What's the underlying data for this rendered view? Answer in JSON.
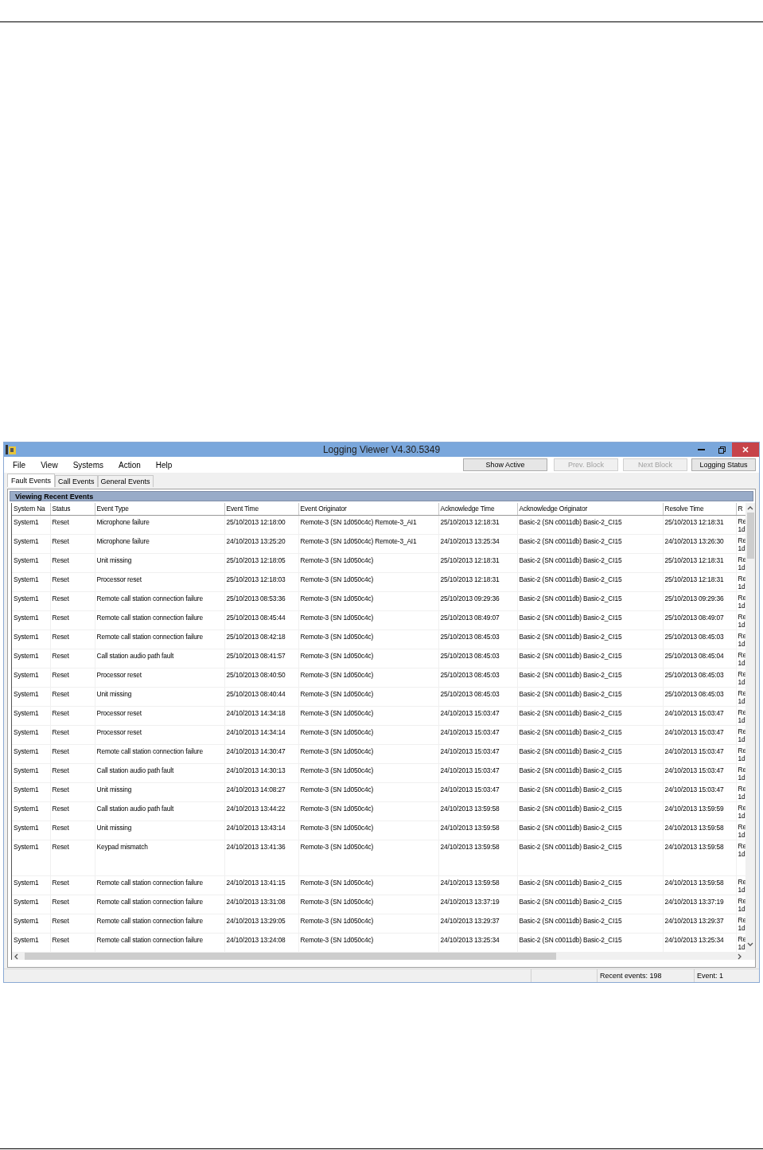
{
  "window": {
    "title": "Logging Viewer V4.30.5349"
  },
  "menu": [
    "File",
    "View",
    "Systems",
    "Action",
    "Help"
  ],
  "buttons": [
    {
      "label": "Show Active",
      "disabled": false
    },
    {
      "label": "Prev. Block",
      "disabled": true
    },
    {
      "label": "Next Block",
      "disabled": true
    },
    {
      "label": "Logging Status",
      "disabled": false
    }
  ],
  "tabs": [
    {
      "label": "Fault Events",
      "selected": true
    },
    {
      "label": "Call Events",
      "selected": false
    },
    {
      "label": "General Events",
      "selected": false
    }
  ],
  "panel": {
    "title": "Viewing Recent Events"
  },
  "table": {
    "columns": [
      "System Na",
      "Status",
      "Event Type",
      "Event Time",
      "Event Originator",
      "Acknowledge Time",
      "Acknowledge Originator",
      "Resolve Time",
      "R"
    ],
    "rows": [
      {
        "cells": [
          "System1",
          "Reset",
          "Microphone failure",
          "25/10/2013 12:18:00",
          "Remote-3 (SN 1d050c4c) Remote-3_AI1",
          "25/10/2013 12:18:31",
          "Basic-2 (SN c0011db) Basic-2_CI15",
          "25/10/2013 12:18:31",
          "Re 1d"
        ]
      },
      {
        "cells": [
          "System1",
          "Reset",
          "Microphone failure",
          "24/10/2013 13:25:20",
          "Remote-3 (SN 1d050c4c) Remote-3_AI1",
          "24/10/2013 13:25:34",
          "Basic-2 (SN c0011db) Basic-2_CI15",
          "24/10/2013 13:26:30",
          "Re 1d"
        ]
      },
      {
        "cells": [
          "System1",
          "Reset",
          "Unit missing",
          "25/10/2013 12:18:05",
          "Remote-3 (SN 1d050c4c)",
          "25/10/2013 12:18:31",
          "Basic-2 (SN c0011db) Basic-2_CI15",
          "25/10/2013 12:18:31",
          "Re 1d"
        ]
      },
      {
        "cells": [
          "System1",
          "Reset",
          "Processor reset",
          "25/10/2013 12:18:03",
          "Remote-3 (SN 1d050c4c)",
          "25/10/2013 12:18:31",
          "Basic-2 (SN c0011db) Basic-2_CI15",
          "25/10/2013 12:18:31",
          "Re 1d"
        ]
      },
      {
        "cells": [
          "System1",
          "Reset",
          "Remote call station connection failure",
          "25/10/2013 08:53:36",
          "Remote-3 (SN 1d050c4c)",
          "25/10/2013 09:29:36",
          "Basic-2 (SN c0011db) Basic-2_CI15",
          "25/10/2013 09:29:36",
          "Re 1d"
        ]
      },
      {
        "cells": [
          "System1",
          "Reset",
          "Remote call station connection failure",
          "25/10/2013 08:45:44",
          "Remote-3 (SN 1d050c4c)",
          "25/10/2013 08:49:07",
          "Basic-2 (SN c0011db) Basic-2_CI15",
          "25/10/2013 08:49:07",
          "Re 1d"
        ]
      },
      {
        "cells": [
          "System1",
          "Reset",
          "Remote call station connection failure",
          "25/10/2013 08:42:18",
          "Remote-3 (SN 1d050c4c)",
          "25/10/2013 08:45:03",
          "Basic-2 (SN c0011db) Basic-2_CI15",
          "25/10/2013 08:45:03",
          "Re 1d"
        ]
      },
      {
        "cells": [
          "System1",
          "Reset",
          "Call station audio path fault",
          "25/10/2013 08:41:57",
          "Remote-3 (SN 1d050c4c)",
          "25/10/2013 08:45:03",
          "Basic-2 (SN c0011db) Basic-2_CI15",
          "25/10/2013 08:45:04",
          "Re 1d"
        ]
      },
      {
        "cells": [
          "System1",
          "Reset",
          "Processor reset",
          "25/10/2013 08:40:50",
          "Remote-3 (SN 1d050c4c)",
          "25/10/2013 08:45:03",
          "Basic-2 (SN c0011db) Basic-2_CI15",
          "25/10/2013 08:45:03",
          "Re 1d"
        ]
      },
      {
        "cells": [
          "System1",
          "Reset",
          "Unit missing",
          "25/10/2013 08:40:44",
          "Remote-3 (SN 1d050c4c)",
          "25/10/2013 08:45:03",
          "Basic-2 (SN c0011db) Basic-2_CI15",
          "25/10/2013 08:45:03",
          "Re 1d"
        ]
      },
      {
        "cells": [
          "System1",
          "Reset",
          "Processor reset",
          "24/10/2013 14:34:18",
          "Remote-3 (SN 1d050c4c)",
          "24/10/2013 15:03:47",
          "Basic-2 (SN c0011db) Basic-2_CI15",
          "24/10/2013 15:03:47",
          "Re 1d"
        ]
      },
      {
        "cells": [
          "System1",
          "Reset",
          "Processor reset",
          "24/10/2013 14:34:14",
          "Remote-3 (SN 1d050c4c)",
          "24/10/2013 15:03:47",
          "Basic-2 (SN c0011db) Basic-2_CI15",
          "24/10/2013 15:03:47",
          "Re 1d"
        ]
      },
      {
        "cells": [
          "System1",
          "Reset",
          "Remote call station connection failure",
          "24/10/2013 14:30:47",
          "Remote-3 (SN 1d050c4c)",
          "24/10/2013 15:03:47",
          "Basic-2 (SN c0011db) Basic-2_CI15",
          "24/10/2013 15:03:47",
          "Re 1d"
        ]
      },
      {
        "cells": [
          "System1",
          "Reset",
          "Call station audio path fault",
          "24/10/2013 14:30:13",
          "Remote-3 (SN 1d050c4c)",
          "24/10/2013 15:03:47",
          "Basic-2 (SN c0011db) Basic-2_CI15",
          "24/10/2013 15:03:47",
          "Re 1d"
        ]
      },
      {
        "cells": [
          "System1",
          "Reset",
          "Unit missing",
          "24/10/2013 14:08:27",
          "Remote-3 (SN 1d050c4c)",
          "24/10/2013 15:03:47",
          "Basic-2 (SN c0011db) Basic-2_CI15",
          "24/10/2013 15:03:47",
          "Re 1d"
        ]
      },
      {
        "cells": [
          "System1",
          "Reset",
          "Call station audio path fault",
          "24/10/2013 13:44:22",
          "Remote-3 (SN 1d050c4c)",
          "24/10/2013 13:59:58",
          "Basic-2 (SN c0011db) Basic-2_CI15",
          "24/10/2013 13:59:59",
          "Re 1d"
        ]
      },
      {
        "cells": [
          "System1",
          "Reset",
          "Unit missing",
          "24/10/2013 13:43:14",
          "Remote-3 (SN 1d050c4c)",
          "24/10/2013 13:59:58",
          "Basic-2 (SN c0011db) Basic-2_CI15",
          "24/10/2013 13:59:58",
          "Re 1d"
        ]
      },
      {
        "cells": [
          "System1",
          "Reset",
          "Keypad mismatch",
          "24/10/2013 13:41:36",
          "Remote-3 (SN 1d050c4c)",
          "24/10/2013 13:59:58",
          "Basic-2 (SN c0011db) Basic-2_CI15",
          "24/10/2013 13:59:58",
          "Re 1d"
        ],
        "tall": true
      },
      {
        "cells": [
          "System1",
          "Reset",
          "Remote call station connection failure",
          "24/10/2013 13:41:15",
          "Remote-3 (SN 1d050c4c)",
          "24/10/2013 13:59:58",
          "Basic-2 (SN c0011db) Basic-2_CI15",
          "24/10/2013 13:59:58",
          "Re 1d"
        ]
      },
      {
        "cells": [
          "System1",
          "Reset",
          "Remote call station connection failure",
          "24/10/2013 13:31:08",
          "Remote-3 (SN 1d050c4c)",
          "24/10/2013 13:37:19",
          "Basic-2 (SN c0011db) Basic-2_CI15",
          "24/10/2013 13:37:19",
          "Re 1d"
        ]
      },
      {
        "cells": [
          "System1",
          "Reset",
          "Remote call station connection failure",
          "24/10/2013 13:29:05",
          "Remote-3 (SN 1d050c4c)",
          "24/10/2013 13:29:37",
          "Basic-2 (SN c0011db) Basic-2_CI15",
          "24/10/2013 13:29:37",
          "Re 1d"
        ]
      },
      {
        "cells": [
          "System1",
          "Reset",
          "Remote call station connection failure",
          "24/10/2013 13:24:08",
          "Remote-3 (SN 1d050c4c)",
          "24/10/2013 13:25:34",
          "Basic-2 (SN c0011db) Basic-2_CI15",
          "24/10/2013 13:25:34",
          "Re 1d"
        ]
      }
    ]
  },
  "status_bar": [
    "Recent events: 198",
    "Event: 1"
  ]
}
